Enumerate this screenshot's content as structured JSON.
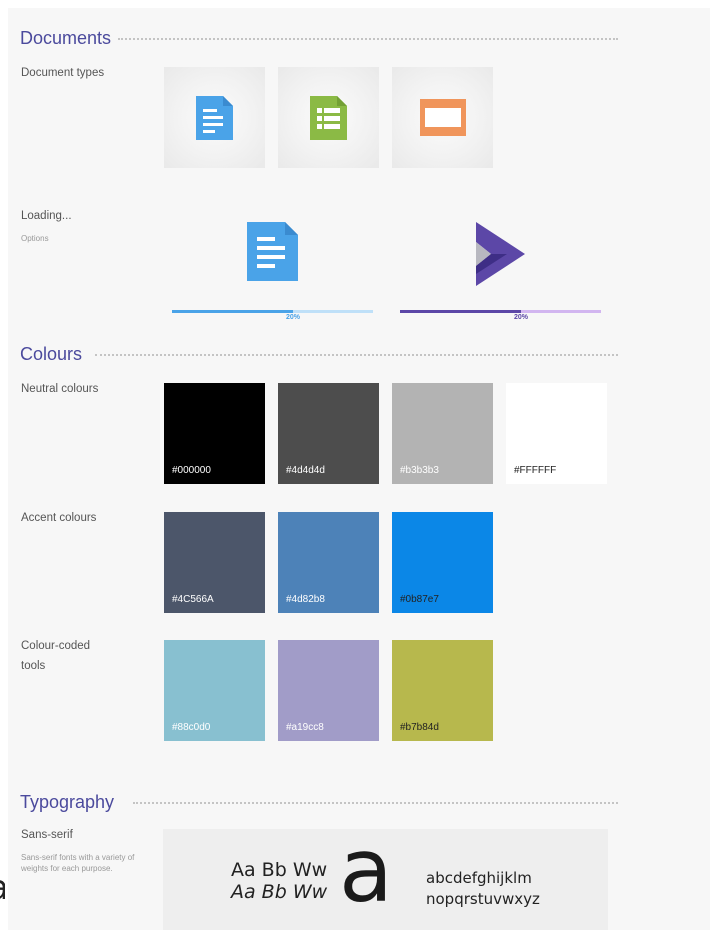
{
  "sections": {
    "documents": "Documents",
    "colours": "Colours",
    "typography": "Typography"
  },
  "documents": {
    "types_label": "Document types",
    "types": [
      {
        "icon": "document-icon",
        "color": "#4aa3e8"
      },
      {
        "icon": "spreadsheet-icon",
        "color": "#8bba45"
      },
      {
        "icon": "presentation-icon",
        "color": "#f0955b"
      }
    ],
    "loading_label": "Loading...",
    "loading_sub": "Options",
    "loaders": [
      {
        "icon": "document-icon",
        "progress_pct": 20,
        "text": "20%",
        "fill_color": "#4aa3e8",
        "track_color": "#bfe0f8",
        "text_color": "#4aa3e8"
      },
      {
        "icon": "logo-icon",
        "progress_pct": 20,
        "text": "20%",
        "fill_color": "#5c47a7",
        "track_color": "#d2b6f0",
        "text_color": "#5c47a7"
      }
    ]
  },
  "colours": {
    "neutral_label": "Neutral colours",
    "neutral": [
      {
        "hex": "#000000",
        "label": "#000000",
        "text_color": "#ffffff"
      },
      {
        "hex": "#4d4d4d",
        "label": "#4d4d4d",
        "text_color": "#ffffff"
      },
      {
        "hex": "#b3b3b3",
        "label": "#b3b3b3",
        "text_color": "#ffffff"
      },
      {
        "hex": "#ffffff",
        "label": "#FFFFFF",
        "text_color": "#222222"
      }
    ],
    "accent_label": "Accent colours",
    "accent": [
      {
        "hex": "#4c566a",
        "label": "#4C566A",
        "text_color": "#ffffff"
      },
      {
        "hex": "#4d82b8",
        "label": "#4d82b8",
        "text_color": "#ffffff"
      },
      {
        "hex": "#0b87e7",
        "label": "#0b87e7",
        "text_color": "#222222"
      }
    ],
    "coded_label_line1": "Colour-coded",
    "coded_label_line2": "tools",
    "coded": [
      {
        "hex": "#88c0d0",
        "label": "#88c0d0",
        "text_color": "#ffffff"
      },
      {
        "hex": "#a19cc8",
        "label": "#a19cc8",
        "text_color": "#ffffff"
      },
      {
        "hex": "#b7b84d",
        "label": "#b7b84d",
        "text_color": "#222222"
      }
    ]
  },
  "typography": {
    "sans_label": "Sans-serif",
    "sans_desc_line1": "Sans-serif fonts with a variety of",
    "sans_desc_line2": "weights for each purpose.",
    "sample_regular": "Aa Bb Ww",
    "sample_italic": "Aa Bb Ww",
    "big_glyph": "a",
    "lowercase_line1": "abcdefghijklm",
    "lowercase_line2": "nopqrstuvwxyz"
  },
  "edge_glyph": "a"
}
